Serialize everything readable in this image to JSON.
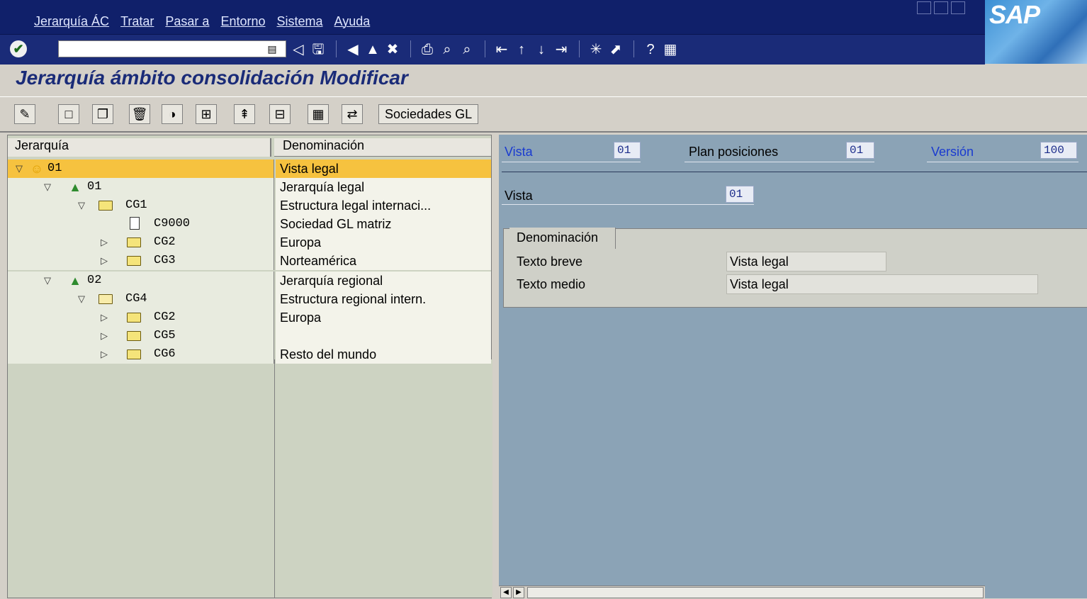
{
  "menu": [
    "Jerarquía ÁC",
    "Tratar",
    "Pasar a",
    "Entorno",
    "Sistema",
    "Ayuda"
  ],
  "logo": "SAP",
  "command_field": {
    "value": ""
  },
  "page_title": "Jerarquía ámbito consolidación Modificar",
  "app_toolbar": {
    "societies_button": "Sociedades GL"
  },
  "tree": {
    "col_hierarchy": "Jerarquía",
    "col_name": "Denominación",
    "rows": [
      {
        "code": "01",
        "name": "Vista legal",
        "icon": "user-icon",
        "expand": "expanded",
        "level": 0
      },
      {
        "code": "01",
        "name": "Jerarquía legal",
        "icon": "tree-icon",
        "expand": "expanded",
        "level": 1
      },
      {
        "code": "CG1",
        "name": "Estructura legal internaci...",
        "icon": "folder-icon",
        "expand": "expanded",
        "level": 2
      },
      {
        "code": "C9000",
        "name": "Sociedad GL matriz",
        "icon": "document-icon",
        "expand": "none",
        "level": 3
      },
      {
        "code": "CG2",
        "name": "Europa",
        "icon": "folder-icon",
        "expand": "collapsed",
        "level": 3
      },
      {
        "code": "CG3",
        "name": "Norteamérica",
        "icon": "folder-icon",
        "expand": "collapsed",
        "level": 3
      },
      {
        "code": "02",
        "name": "Jerarquía regional",
        "icon": "tree-icon",
        "expand": "expanded",
        "level": 1
      },
      {
        "code": "CG4",
        "name": "Estructura regional intern.",
        "icon": "open-folder-icon",
        "expand": "expanded",
        "level": 2
      },
      {
        "code": "CG2",
        "name": "Europa",
        "icon": "folder-icon",
        "expand": "collapsed",
        "level": 3
      },
      {
        "code": "CG5",
        "name": "",
        "icon": "folder-icon",
        "expand": "collapsed",
        "level": 3
      },
      {
        "code": "CG6",
        "name": "Resto del mundo",
        "icon": "folder-icon",
        "expand": "collapsed",
        "level": 3
      }
    ]
  },
  "header_fields": {
    "view_label": "Vista",
    "view_value": "01",
    "plan_label": "Plan posiciones",
    "plan_value": "01",
    "version_label": "Versión",
    "version_value": "100"
  },
  "detail": {
    "view_label": "Vista",
    "view_value": "01",
    "group_tab": "Denominación",
    "short_text_label": "Texto breve",
    "short_text_value": "Vista legal",
    "medium_text_label": "Texto medio",
    "medium_text_value": "Vista legal"
  },
  "colors": {
    "menubar": "#10206a",
    "title": "#1a2b78",
    "selected_row": "#f6c23f",
    "right_panel": "#8ba3b6"
  }
}
